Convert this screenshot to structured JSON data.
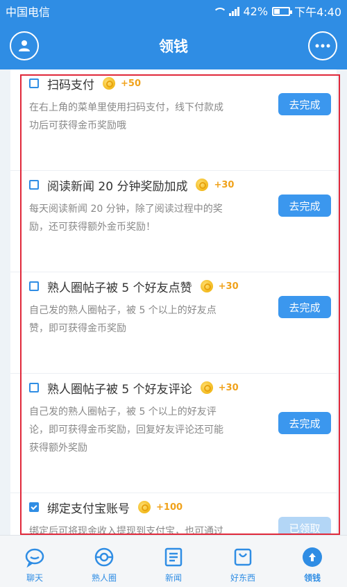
{
  "status_bar": {
    "carrier": "中国电信",
    "battery": "42%",
    "time": "下午4:40",
    "battery_level": 0.42
  },
  "header": {
    "title": "领钱"
  },
  "tasks": [
    {
      "title": "扫码支付",
      "reward": "+50",
      "desc_lines": [
        "在右上角的菜单里使用扫码支付，线下付款成",
        "功后可获得金币奖励哦"
      ],
      "button": "去完成",
      "checked": false
    },
    {
      "title": "阅读新闻 20 分钟奖励加成",
      "reward": "+30",
      "desc_lines": [
        "每天阅读新闻 20 分钟，除了阅读过程中的奖",
        "励，还可获得额外金币奖励！"
      ],
      "button": "去完成",
      "checked": false
    },
    {
      "title": "熟人圈帖子被 5 个好友点赞",
      "reward": "+30",
      "desc_lines": [
        "自己发的熟人圈帖子，被 5 个以上的好友点",
        "赞，即可获得金币奖励"
      ],
      "button": "去完成",
      "checked": false
    },
    {
      "title": "熟人圈帖子被 5 个好友评论",
      "reward": "+30",
      "desc_lines": [
        "自己发的熟人圈帖子，被 5 个以上的好友评",
        "论，即可获得金币奖励，回复好友评论还可能",
        "获得额外奖励"
      ],
      "button": "去完成",
      "checked": false
    },
    {
      "title": "绑定支付宝账号",
      "reward": "+100",
      "desc_lines": [
        "绑定后可将现金收入提现到支付宝，也可通过"
      ],
      "button": "已领取",
      "checked": true
    }
  ],
  "tabs": [
    {
      "label": "聊天",
      "icon": "chat-icon"
    },
    {
      "label": "熟人圈",
      "icon": "circle-icon"
    },
    {
      "label": "新闻",
      "icon": "news-icon"
    },
    {
      "label": "好东西",
      "icon": "bag-icon"
    },
    {
      "label": "领钱",
      "icon": "money-icon"
    }
  ],
  "colors": {
    "primary": "#2f8de4",
    "highlight": "#e0283a",
    "reward": "#f0a21b"
  }
}
